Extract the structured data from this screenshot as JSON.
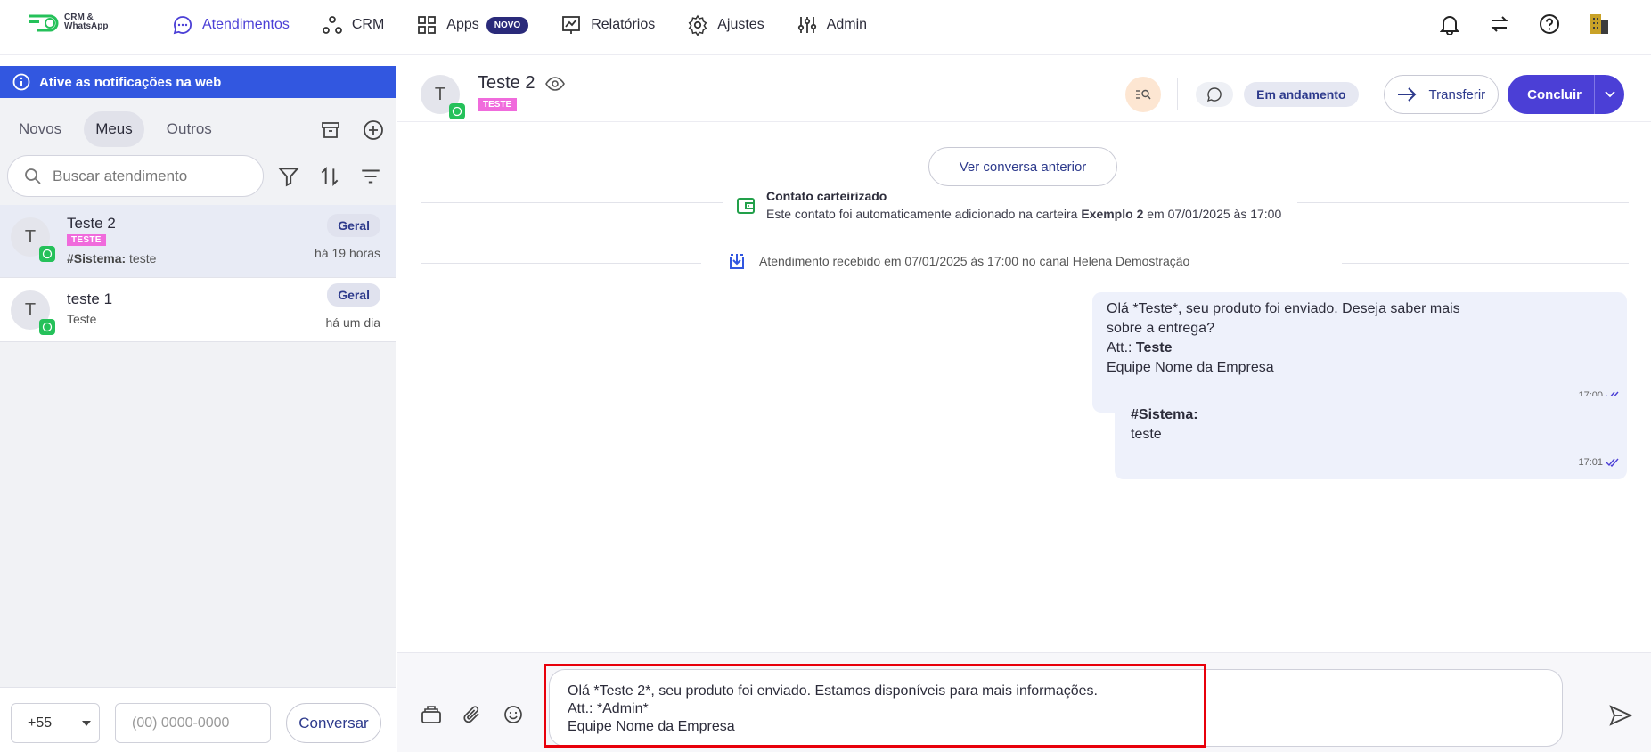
{
  "brand": {
    "logo_line1": "CRM &",
    "logo_line2": "WhatsApp"
  },
  "nav": {
    "items": [
      {
        "label": "Atendimentos",
        "icon": "chat-bubble-icon",
        "active": true
      },
      {
        "label": "CRM",
        "icon": "crm-nodes-icon"
      },
      {
        "label": "Apps",
        "icon": "apps-grid-icon",
        "badge": "NOVO"
      },
      {
        "label": "Relatórios",
        "icon": "chart-icon"
      },
      {
        "label": "Ajustes",
        "icon": "gear-icon"
      },
      {
        "label": "Admin",
        "icon": "sliders-icon"
      }
    ]
  },
  "notification_bar": {
    "text": "Ative as notificações na web"
  },
  "tabs": [
    "Novos",
    "Meus",
    "Outros"
  ],
  "search": {
    "placeholder": "Buscar atendimento"
  },
  "conversations": [
    {
      "avatar": "T",
      "name": "Teste 2",
      "tag": "TESTE",
      "preview_bold": "#Sistema:",
      "preview": " teste",
      "dept": "Geral",
      "time": "há 19 horas"
    },
    {
      "avatar": "T",
      "name": "teste 1",
      "preview": "Teste",
      "dept": "Geral",
      "time": "há um dia"
    }
  ],
  "new_chat": {
    "ddi": "+55",
    "phone_placeholder": "(00) 0000-0000",
    "button": "Conversar"
  },
  "chat": {
    "avatar": "T",
    "name": "Teste 2",
    "tag": "TESTE",
    "status": "Em andamento",
    "transfer_label": "Transferir",
    "conclude_label": "Concluir",
    "prev_button": "Ver conversa anterior",
    "system1": {
      "title": "Contato carteirizado",
      "text_a": "Este contato foi automaticamente adicionado na carteira ",
      "text_b": "Exemplo 2",
      "text_c": " em 07/01/2025 às 17:00"
    },
    "system2": "Atendimento recebido em 07/01/2025 às 17:00 no canal Helena Demostração",
    "messages": [
      {
        "line1": "Olá *Teste*, seu produto foi enviado. Deseja saber mais",
        "line2": "sobre a entrega?",
        "line3a": "Att.: ",
        "line3b": "Teste",
        "line4": "Equipe Nome da Empresa",
        "time": "17:00"
      },
      {
        "title": "#Sistema:",
        "text": "teste",
        "time": "17:01"
      }
    ],
    "composer": {
      "line1": "Olá *Teste 2*, seu produto foi enviado. Estamos disponíveis para mais informações.",
      "line2": "Att.: *Admin*",
      "line3": "Equipe Nome da Empresa"
    }
  },
  "colors": {
    "accent": "#4b3fd6",
    "notif": "#3257e0",
    "tag": "#f06bdc",
    "whatsapp": "#25c15a",
    "highlight": "#e8000b"
  }
}
